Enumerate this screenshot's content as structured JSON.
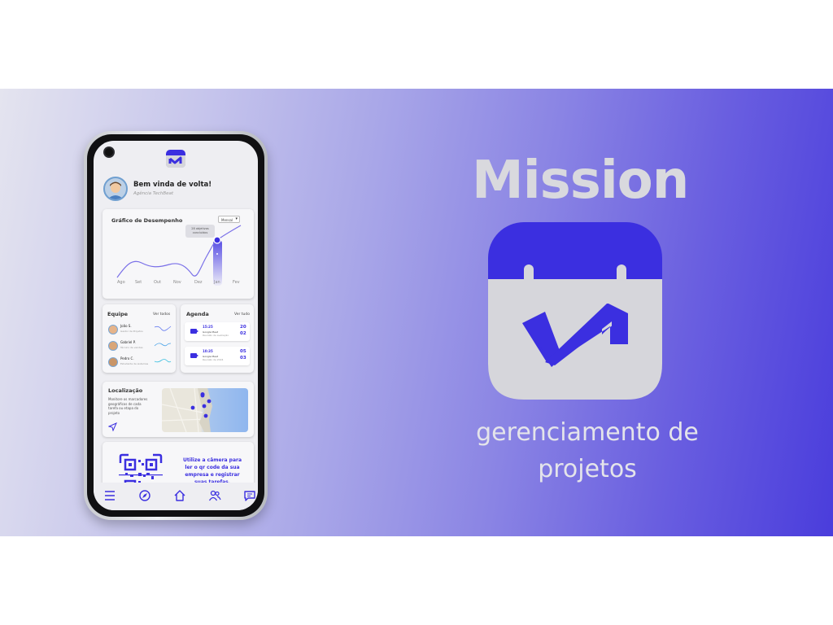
{
  "brand": {
    "title": "Mission",
    "tagline_line1": "gerenciamento de",
    "tagline_line2": "projetos",
    "logo_icon": "mission-calendar-check-icon",
    "colors": {
      "primary": "#3b2fe0",
      "logo_body": "#d6d6db",
      "banner_start": "#e4e4ef",
      "banner_end": "#4a3ddc"
    }
  },
  "app": {
    "greeting": "Bem vinda de volta!",
    "agency": "Agência TechBeat",
    "performance": {
      "title": "Gráfico de Desempenho",
      "filter": "Mensal",
      "tooltip": "28 objetivos concluídos",
      "months": [
        "Ago",
        "Set",
        "Out",
        "Nov",
        "Dez",
        "Jan",
        "Fev"
      ]
    },
    "team": {
      "title": "Equipe",
      "see_all": "Ver todos",
      "members": [
        {
          "name": "João S.",
          "role": "Gestor de Projetos"
        },
        {
          "name": "Gabriel P.",
          "role": "Técnico de vendas"
        },
        {
          "name": "Pedro C.",
          "role": "Estudante de sistemas"
        }
      ]
    },
    "agenda": {
      "title": "Agenda",
      "see_all": "Ver tudo",
      "events": [
        {
          "time": "15:25",
          "app": "Google Meet",
          "desc": "Reunião de avaliação",
          "day": "20",
          "month": "02"
        },
        {
          "time": "10:35",
          "app": "Google Meet",
          "desc": "Reunião de 2024",
          "day": "05",
          "month": "03"
        }
      ]
    },
    "location": {
      "title": "Localização",
      "text_lines": [
        "Monitore os marcadores",
        "geográficos de cada",
        "tarefa ou etapa do",
        "projeto"
      ]
    },
    "qr": {
      "text_lines": [
        "Utilize a câmera para",
        "ler o qr code da sua",
        "empresa e registrar",
        "suas tarefas."
      ]
    },
    "nav": [
      "menu-icon",
      "compass-icon",
      "home-icon",
      "users-icon",
      "chat-icon"
    ]
  }
}
